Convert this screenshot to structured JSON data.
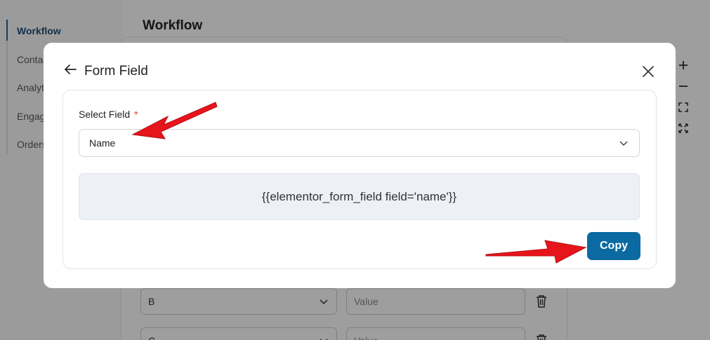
{
  "sidebar": {
    "items": [
      {
        "label": "Workflow",
        "active": true
      },
      {
        "label": "Contacts",
        "active": false
      },
      {
        "label": "Analytics",
        "active": false
      },
      {
        "label": "Engagement",
        "active": false
      },
      {
        "label": "Orders",
        "active": false
      }
    ]
  },
  "page": {
    "title": "Workflow"
  },
  "background_rows": [
    {
      "key": "B",
      "value_placeholder": "Value"
    },
    {
      "key": "C",
      "value_placeholder": "Value"
    }
  ],
  "zoom_tools": [
    "zoom-in-icon",
    "zoom-out-icon",
    "fit-view-icon",
    "fullscreen-icon"
  ],
  "modal": {
    "title": "Form Field",
    "select_label": "Select Field",
    "required_marker": "*",
    "selected_field": "Name",
    "shortcode": "{{elementor_form_field field='name'}}",
    "copy_label": "Copy"
  },
  "colors": {
    "primary": "#0a6aa1",
    "required": "#e53935",
    "annotation_arrow": "#e8141b",
    "shortcode_bg": "#eef0f7",
    "overlay": "rgba(0,0,0,0.38)"
  }
}
